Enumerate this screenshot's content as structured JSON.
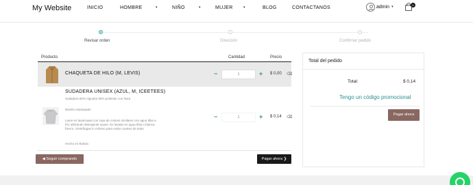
{
  "brand": "My Website",
  "nav": {
    "items": [
      {
        "label": "INICIO"
      },
      {
        "label": "HOMBRE"
      },
      {
        "label": "NIÑO"
      },
      {
        "label": "MUJER"
      },
      {
        "label": "BLOG"
      },
      {
        "label": "CONTACTANOS"
      }
    ],
    "dropdown_indicator": "▾"
  },
  "user": {
    "name": "admin",
    "caret": "▾"
  },
  "cart": {
    "count": "0"
  },
  "steps": [
    {
      "label": "Revisar orden",
      "active": true
    },
    {
      "label": "Dirección",
      "active": false
    },
    {
      "label": "Confirmar pedido",
      "active": false
    }
  ],
  "table": {
    "headers": {
      "product": "Producto",
      "quantity": "Cantidad",
      "price": "Precio"
    },
    "rows": [
      {
        "name": "CHAQUETA DE HILO (M, LEVIS)",
        "quantity": "1",
        "price": "$ 0,00",
        "description": []
      },
      {
        "name": "SUDADERA UNISEX (AZUL, M, ICEETEES)",
        "quantity": "1",
        "price": "$ 0,14",
        "description": [
          "Sudadera 50% Algodón 50% poliester con fixea",
          "Diseño estampado",
          "Lavar en lavarropas con ropa de colores similares con agua tibia a",
          "frío utilizando detergente suave. Es lavado en agua tibia o blanca.",
          "fresco. Centrifugue lo mínimo para evitar cuarteo de telas.",
          "Hecho en Bolivia"
        ]
      }
    ],
    "minus": "−",
    "plus": "+",
    "trash": "⌫"
  },
  "buttons": {
    "continue": "◀ Seguir comprando",
    "pay": "Pagar ahora ❯"
  },
  "summary": {
    "title": "Total del pedido",
    "total_label": "Total:",
    "total_value": "$ 0,14",
    "promo": "Tengo un código promocional",
    "pay_button": "Pagar ahora"
  },
  "colors": {
    "accent": "#2c8f8f",
    "brown": "#8a6761",
    "dark": "#1a1a1a",
    "whatsapp": "#25d366"
  }
}
